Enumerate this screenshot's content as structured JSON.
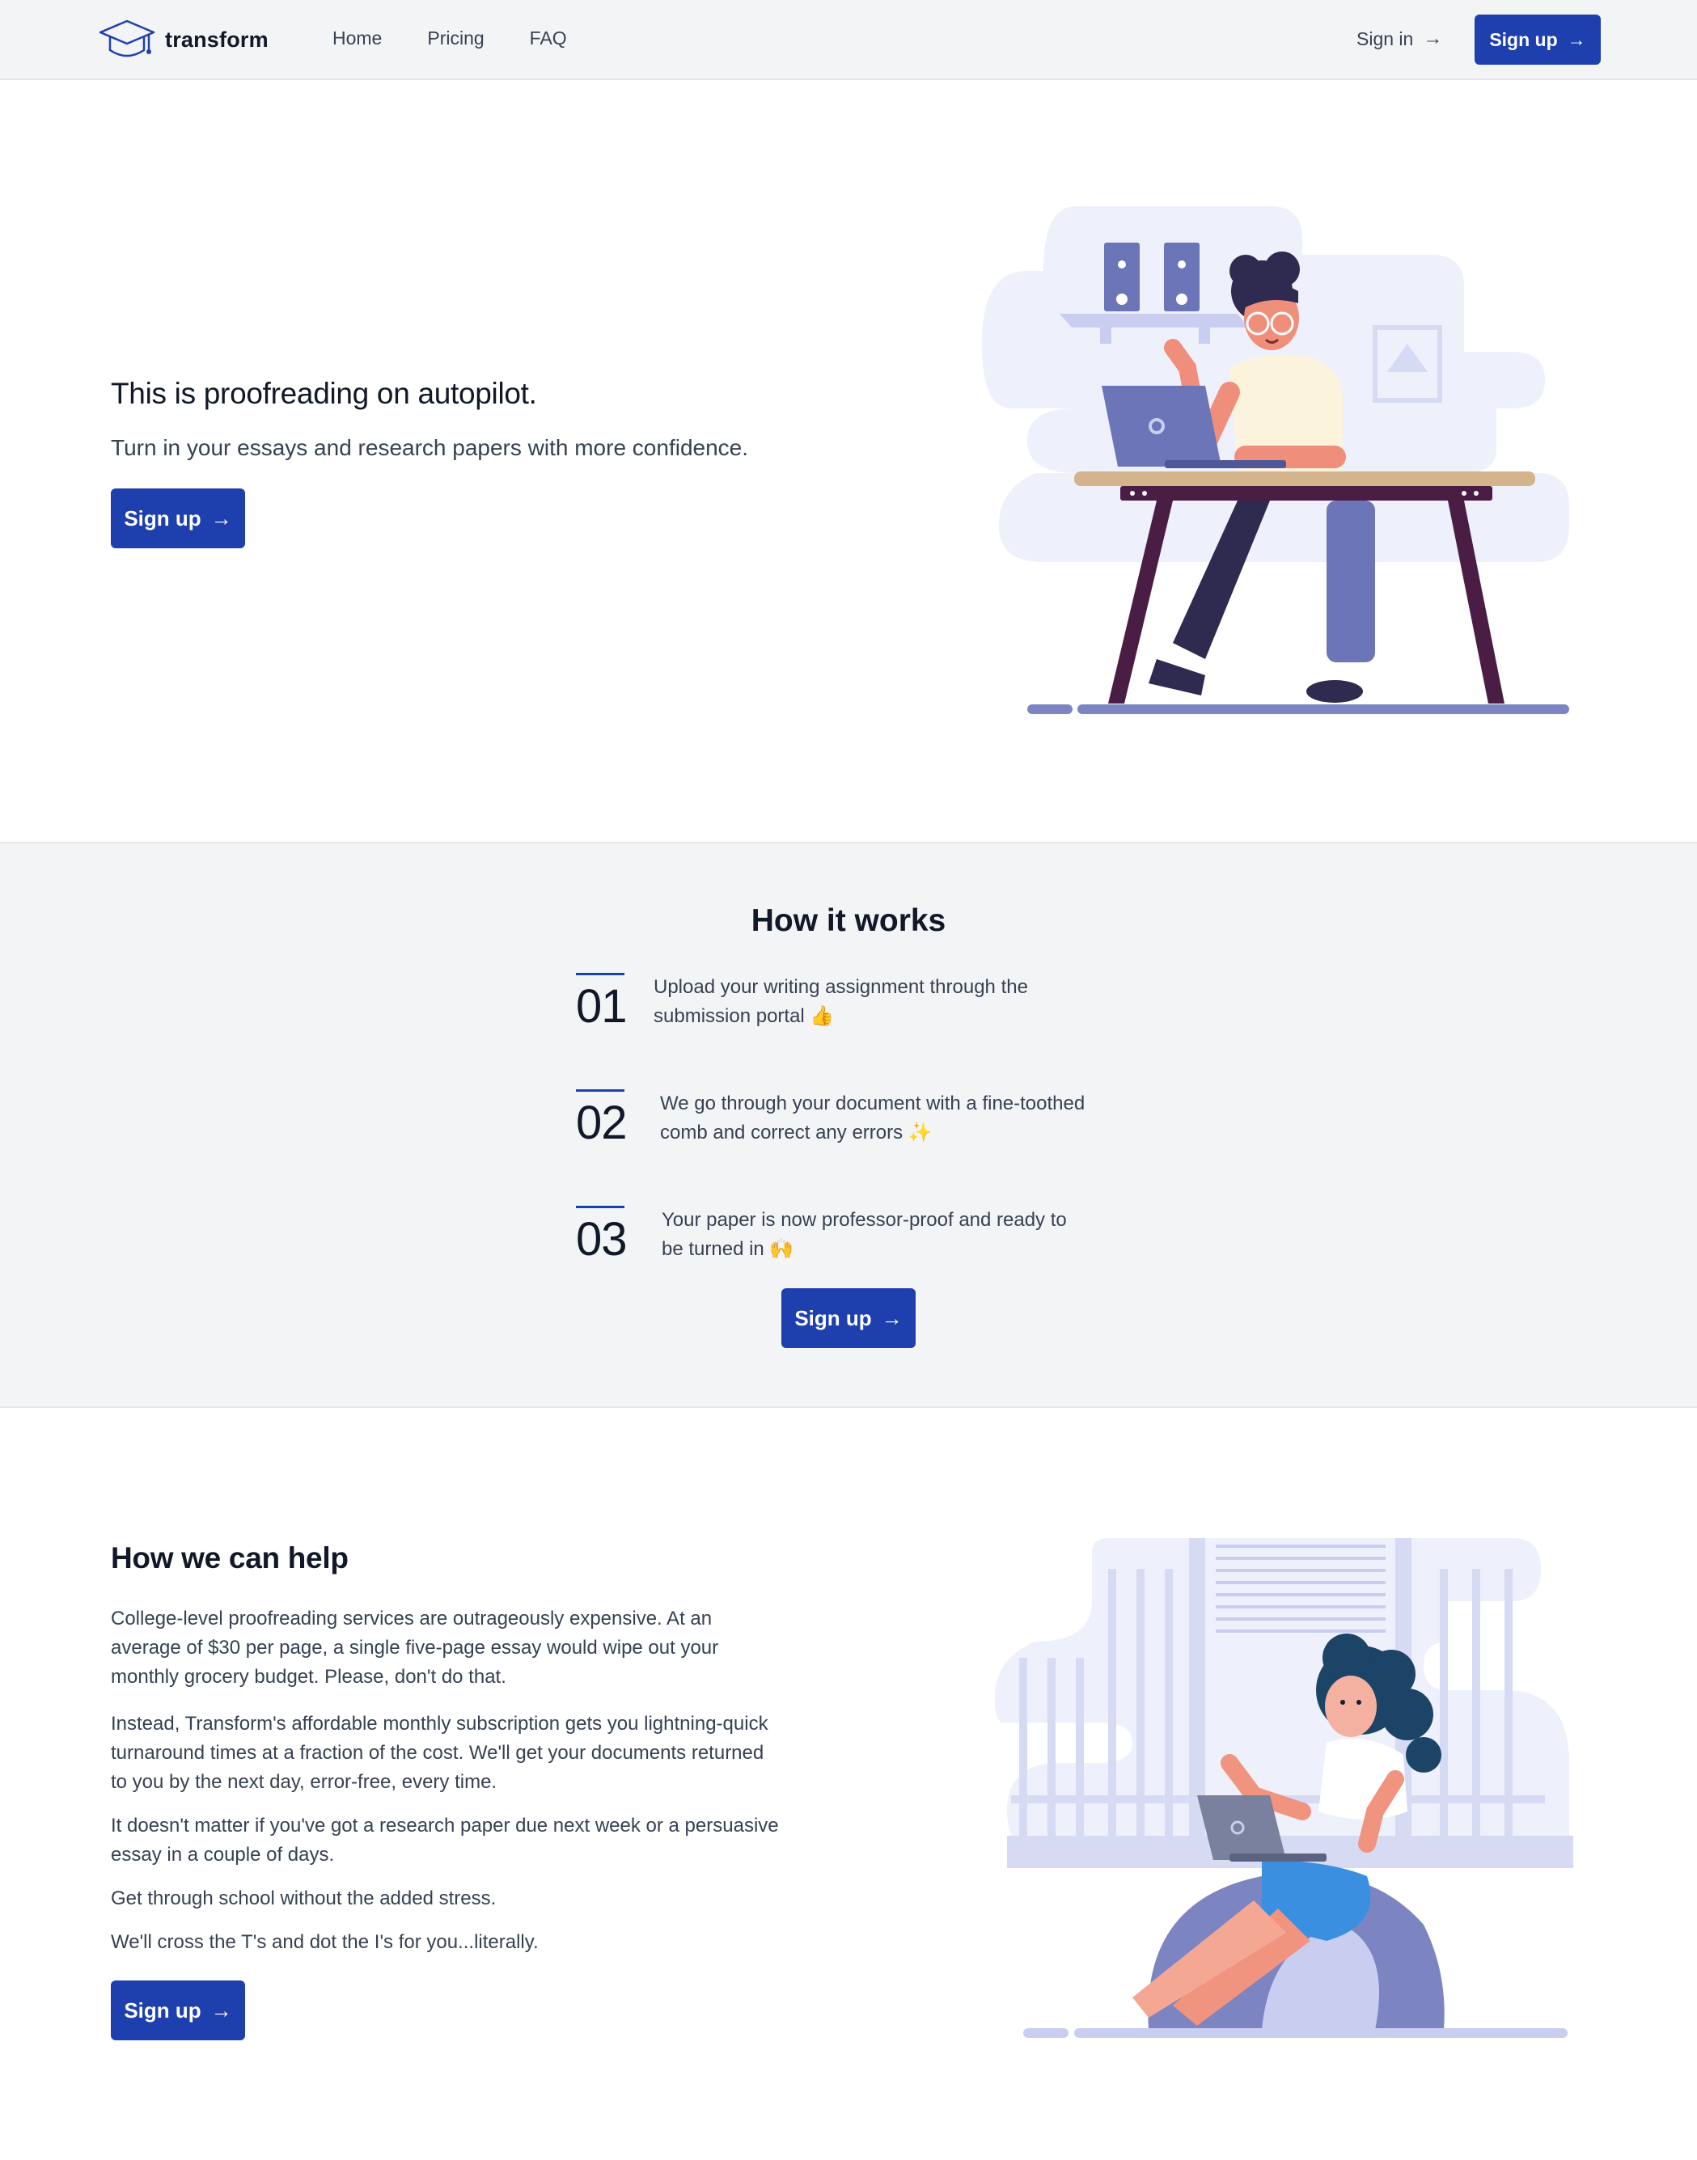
{
  "nav": {
    "brand": "transform",
    "links": [
      "Home",
      "Pricing",
      "FAQ"
    ],
    "signin": "Sign in",
    "signup": "Sign up"
  },
  "hero": {
    "title": "This is proofreading on autopilot.",
    "subtitle": "Turn in your essays and research papers with more confidence.",
    "cta": "Sign up"
  },
  "how": {
    "title": "How it works",
    "steps": [
      {
        "num": "01",
        "line1": "Upload your writing assignment through the",
        "line2": "submission portal 👍"
      },
      {
        "num": "02",
        "line1": "We go through your document with a fine-toothed",
        "line2": "comb and correct any errors ✨"
      },
      {
        "num": "03",
        "line1": "Your paper is now professor-proof and ready to",
        "line2": "be turned in 🙌"
      }
    ],
    "cta": "Sign up"
  },
  "help": {
    "title": "How we can help",
    "paragraphs": [
      {
        "line1": "College-level proofreading services are outrageously expensive. At an",
        "line2": "average of $30 per page, a single five-page essay would wipe out your",
        "line3": "monthly grocery budget. Please, don't do that."
      },
      {
        "line1": "Instead, Transform's affordable monthly subscription gets you lightning-quick",
        "line2": "turnaround times at a fraction of the cost. We'll get your documents returned",
        "line3": "to you by the next day, error-free, every time."
      },
      {
        "line1": "It doesn't matter if you've got a research paper due next week or a persuasive",
        "line2": "essay in a couple of days."
      },
      {
        "line1": "Get through school without the added stress."
      },
      {
        "line1": "We'll cross the T's and dot the I's for you...literally."
      }
    ],
    "cta": "Sign up"
  },
  "colors": {
    "primary": "#1e3fae",
    "nav_bg": "#f3f4f6",
    "section_bg": "#f3f4f6",
    "illustration_bg": "#eef0fb"
  },
  "icons": [
    "graduation-cap-icon",
    "arrow-right-icon"
  ]
}
